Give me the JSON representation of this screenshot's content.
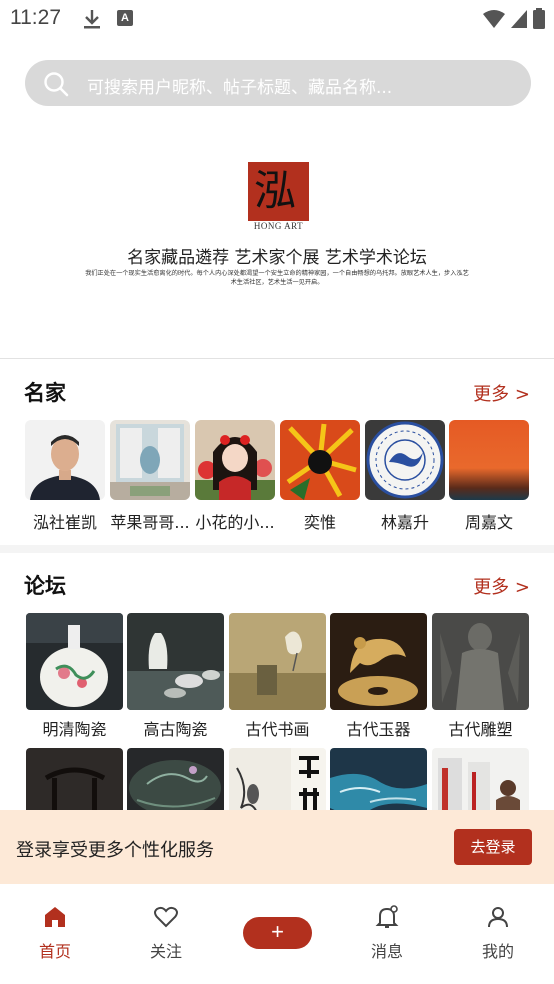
{
  "status": {
    "time": "11:27",
    "notif_letter": "A"
  },
  "search": {
    "placeholder": "可搜索用户昵称、帖子标题、藏品名称..."
  },
  "banner": {
    "logo_text": "HONG ART",
    "headline": "名家藏品遴荐 艺术家个展 艺术学术论坛",
    "description": "我们正处在一个现实生活愈离化的时代。每个人内心深处都渴望一个安生立命的精神家园，一个自由畅想的乌托邦。放眼艺术人生，步入泓艺术生活社区，艺术生活一见开启。"
  },
  "artists_section": {
    "title": "名家",
    "more": "更多 >",
    "items": [
      {
        "name": "泓社崔凯",
        "thumb": "portrait"
      },
      {
        "name": "苹果哥哥...",
        "thumb": "painting"
      },
      {
        "name": "小花的小...",
        "thumb": "anime"
      },
      {
        "name": "奕惟",
        "thumb": "abstract"
      },
      {
        "name": "林嘉升",
        "thumb": "porcelain-plate"
      },
      {
        "name": "周嘉文",
        "thumb": "gradient"
      }
    ]
  },
  "forum_section": {
    "title": "论坛",
    "more": "更多 >",
    "items": [
      {
        "name": "明清陶瓷",
        "thumb": "vase"
      },
      {
        "name": "高古陶瓷",
        "thumb": "gallery"
      },
      {
        "name": "古代书画",
        "thumb": "scroll"
      },
      {
        "name": "古代玉器",
        "thumb": "jade"
      },
      {
        "name": "古代雕塑",
        "thumb": "stone"
      },
      {
        "name": "",
        "thumb": "chair"
      },
      {
        "name": "",
        "thumb": "lacquer"
      },
      {
        "name": "",
        "thumb": "ink"
      },
      {
        "name": "",
        "thumb": "ocean"
      },
      {
        "name": "",
        "thumb": "exhibition"
      }
    ]
  },
  "login_prompt": {
    "text": "登录享受更多个性化服务",
    "button": "去登录"
  },
  "tabbar": {
    "home": "首页",
    "follow": "关注",
    "plus": "+",
    "messages": "消息",
    "mine": "我的"
  },
  "colors": {
    "accent": "#b2301e",
    "login_bg": "#fde9d7",
    "search_bg": "#d9d9d9"
  }
}
